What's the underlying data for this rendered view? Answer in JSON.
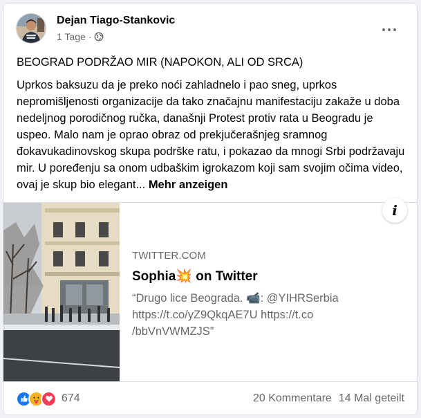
{
  "post": {
    "author": "Dejan Tiago-Stankovic",
    "time": "1 Tage",
    "time_separator": "·",
    "privacy_icon": "globe-icon",
    "more_icon": "more-options-icon",
    "title": "BEOGRAD PODRŽAO MIR (NAPOKON, ALI OD SRCA)",
    "body": "Uprkos baksuzu da je preko noći zahladnelo i pao sneg, uprkos nepromišljenosti organizacije da tako značajnu manifestaciju zakaže u doba nedeljnog porodičnog ručka, današnji Protest protiv rata u Beogradu je uspeo. Malo nam je oprao obraz od prekjučerašnjeg sramnog đokavukadinovskog skupa podrške ratu, i pokazao da mnogi Srbi podržavaju mir. U poređenju sa onom udbaškim igrokazom koji sam svojim očima video, ovaj je skup bio elegant...",
    "see_more": "Mehr anzeigen"
  },
  "link_preview": {
    "info_icon": "info-icon",
    "info_label": "i",
    "domain": "TWITTER.COM",
    "title": "Sophia💥 on Twitter",
    "description": "“Drugo lice Beograda. 📹: @YIHRSerbia https://t.co/yZ9QkqAE7U https://t.co /bbVnVWMZJS”"
  },
  "footer": {
    "reaction_icons": [
      "like-icon",
      "care-icon",
      "love-icon"
    ],
    "reaction_count": "674",
    "comments": "20 Kommentare",
    "shares": "14 Mal geteilt"
  },
  "colors": {
    "like": "#1877f2",
    "love": "#f33e58",
    "care": "#f7b125",
    "secondary_text": "#65676b"
  }
}
